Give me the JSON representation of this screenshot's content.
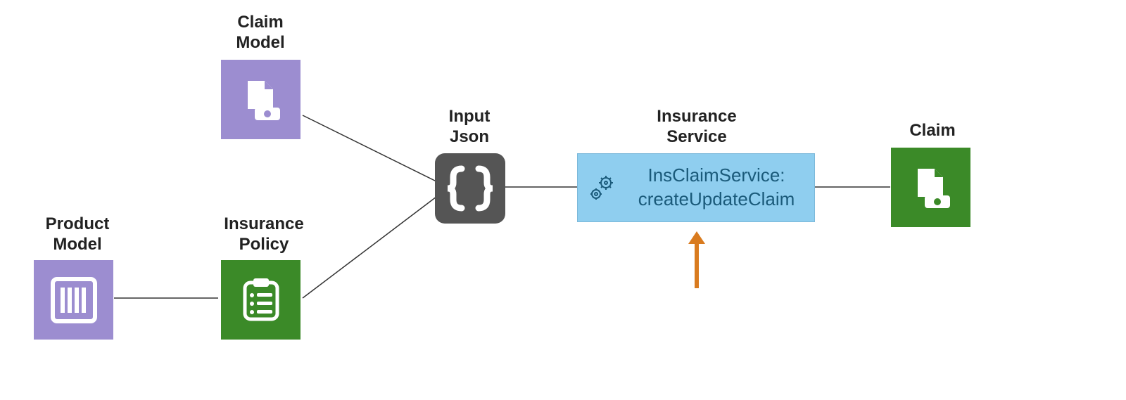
{
  "nodes": {
    "productModel": {
      "label1": "Product",
      "label2": "Model"
    },
    "claimModel": {
      "label1": "Claim",
      "label2": "Model"
    },
    "insurancePolicy": {
      "label1": "Insurance",
      "label2": "Policy"
    },
    "inputJson": {
      "label1": "Input",
      "label2": "Json"
    },
    "insuranceService": {
      "label1": "Insurance",
      "label2": "Service",
      "text1": "InsClaimService:",
      "text2": "createUpdateClaim"
    },
    "claim": {
      "label": "Claim"
    }
  },
  "colors": {
    "purple": "#9c8dd0",
    "green": "#3b8a28",
    "dark": "#555555",
    "blueBox": "#8fceef",
    "arrowOrange": "#d97b1f"
  }
}
